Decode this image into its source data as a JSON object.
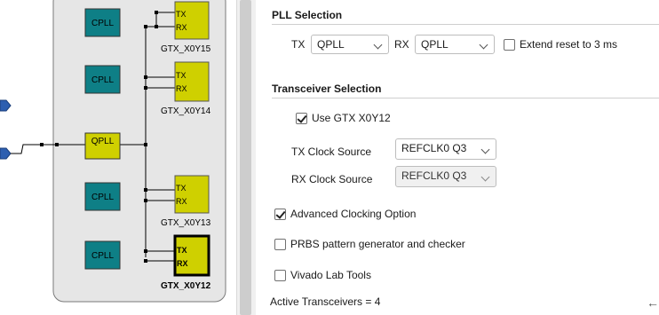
{
  "diagram": {
    "pll_blocks": [
      "CPLL",
      "CPLL",
      "QPLL",
      "CPLL",
      "CPLL"
    ],
    "transceivers": [
      {
        "name": "GTX_X0Y15",
        "tx": "TX",
        "rx": "RX",
        "selected": false
      },
      {
        "name": "GTX_X0Y14",
        "tx": "TX",
        "rx": "RX",
        "selected": false
      },
      {
        "name": "GTX_X0Y13",
        "tx": "TX",
        "rx": "RX",
        "selected": false
      },
      {
        "name": "GTX_X0Y12",
        "tx": "TX",
        "rx": "RX",
        "selected": true
      }
    ],
    "colors": {
      "cpll": "#0e7f86",
      "qpll": "#cfd000",
      "gtx": "#cfd000",
      "port": "#2d5fb0",
      "quad_bg": "#e6e6e6"
    }
  },
  "pll_selection": {
    "title": "PLL Selection",
    "tx_label": "TX",
    "tx_value": "QPLL",
    "rx_label": "RX",
    "rx_value": "QPLL",
    "extend_reset_label": "Extend reset to 3 ms",
    "extend_reset_checked": false
  },
  "transceiver_selection": {
    "title": "Transceiver Selection",
    "use_gtx_label": "Use GTX X0Y12",
    "use_gtx_checked": true,
    "tx_clock_label": "TX Clock Source",
    "tx_clock_value": "REFCLK0 Q3",
    "rx_clock_label": "RX Clock Source",
    "rx_clock_value": "REFCLK0 Q3"
  },
  "options": {
    "advanced_clocking_label": "Advanced Clocking Option",
    "advanced_clocking_checked": true,
    "prbs_label": "PRBS pattern generator and checker",
    "prbs_checked": false,
    "vivado_lab_label": "Vivado Lab Tools",
    "vivado_lab_checked": false
  },
  "status": {
    "active_transceivers": "Active Transceivers = 4"
  }
}
